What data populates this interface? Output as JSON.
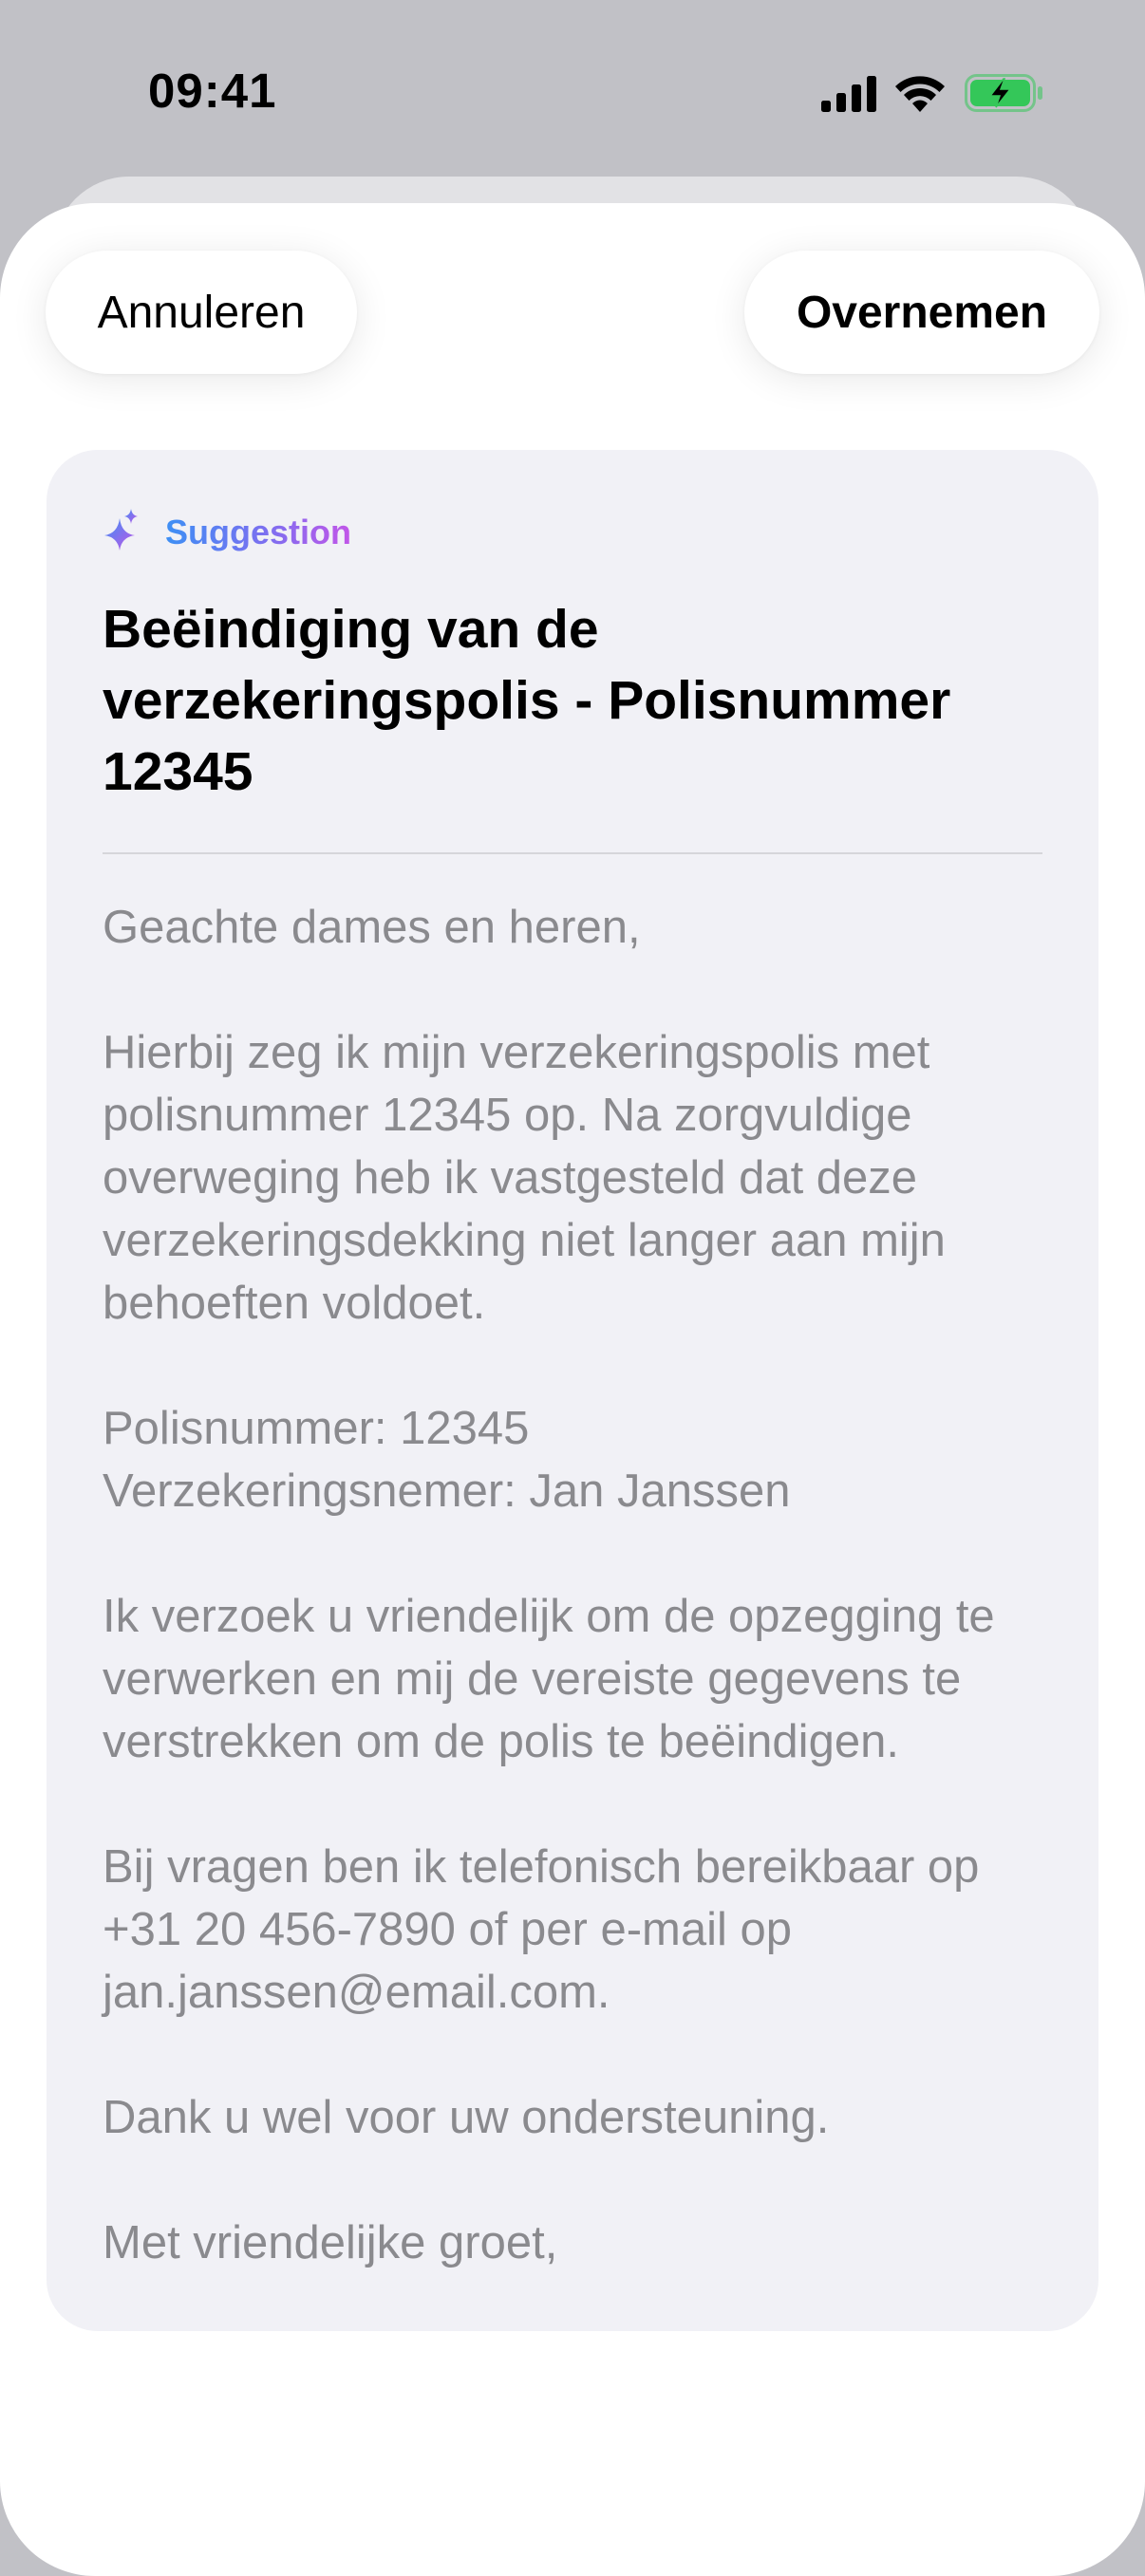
{
  "status_bar": {
    "time": "09:41",
    "icons": [
      "cellular-signal-icon",
      "wifi-icon",
      "battery-charging-icon"
    ],
    "battery_color": "#34c759"
  },
  "toolbar": {
    "cancel_label": "Annuleren",
    "accept_label": "Overnemen"
  },
  "suggestion": {
    "label": "Suggestion",
    "icon": "sparkle-icon",
    "subject": "Beëindiging van de verzekeringspolis - Polisnummer 12345",
    "body": {
      "greeting": "Geachte dames en heren,",
      "paragraph_1": "Hierbij zeg ik mijn verzekeringspolis met polisnummer 12345 op. Na zorgvuldige overweging heb ik vastgesteld dat deze verzekeringsdekking niet langer aan mijn behoeften voldoet.",
      "policy_number_line": "Polisnummer: 12345",
      "policyholder_line": "Verzekeringsnemer: Jan Janssen",
      "paragraph_2": "Ik verzoek u vriendelijk om de opzegging te verwerken en mij de vereiste gegevens te verstrekken om de polis te beëindigen.",
      "paragraph_3": "Bij vragen ben ik telefonisch bereikbaar op +31 20 456-7890 of per e-mail op jan.janssen@email.com.",
      "paragraph_4": "Dank u wel voor uw ondersteuning.",
      "closing": "Met vriendelijke groet,"
    }
  },
  "colors": {
    "background": "#c1c1c6",
    "sheet": "#ffffff",
    "card": "#f1f1f6",
    "body_text": "#8a8a8e",
    "accent_gradient": [
      "#3d8ff4",
      "#c256e8"
    ]
  }
}
